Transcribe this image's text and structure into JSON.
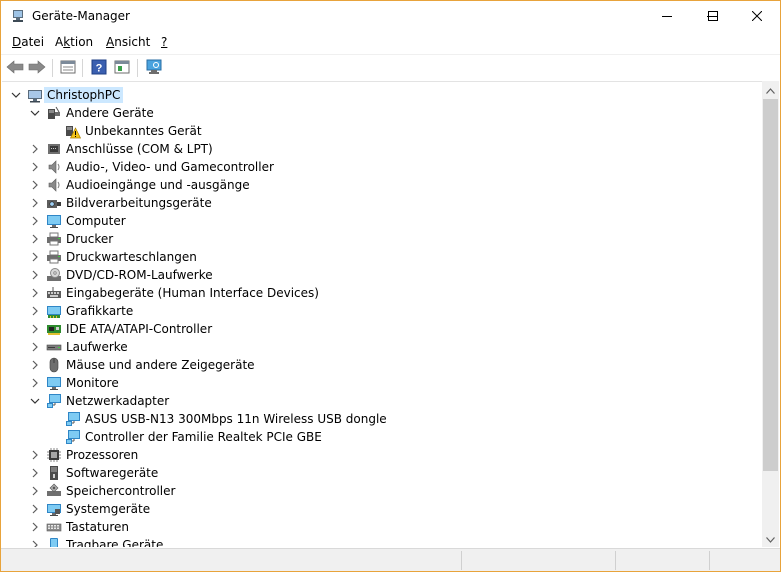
{
  "window": {
    "title": "Geräte-Manager",
    "accent_border_color": "#e8a33b",
    "controls": [
      "minimize-icon",
      "maximize-icon",
      "close-icon"
    ]
  },
  "menu": {
    "items": [
      {
        "label": "Datei",
        "mnemonic_index": 0
      },
      {
        "label": "Aktion",
        "mnemonic_index": 1
      },
      {
        "label": "Ansicht",
        "mnemonic_index": 0
      },
      {
        "label": "?",
        "mnemonic_index": 0
      }
    ]
  },
  "toolbar": {
    "buttons": [
      "back-arrow-icon",
      "forward-arrow-icon",
      "properties-icon",
      "help-icon",
      "update-driver-icon",
      "scan-hardware-icon"
    ]
  },
  "tree": {
    "selection_color": "#cce8ff",
    "nodes": [
      {
        "label": "ChristophPC",
        "level": 0,
        "expander": "expanded",
        "icon": "computer-root-icon",
        "selected": true
      },
      {
        "label": "Andere Geräte",
        "level": 1,
        "expander": "expanded",
        "icon": "other-devices-icon"
      },
      {
        "label": "Unbekanntes Gerät",
        "level": 2,
        "expander": "none",
        "icon": "unknown-device-warning-icon"
      },
      {
        "label": "Anschlüsse (COM & LPT)",
        "level": 1,
        "expander": "collapsed",
        "icon": "port-icon"
      },
      {
        "label": "Audio-, Video- und Gamecontroller",
        "level": 1,
        "expander": "collapsed",
        "icon": "speaker-icon"
      },
      {
        "label": "Audioeingänge und -ausgänge",
        "level": 1,
        "expander": "collapsed",
        "icon": "speaker-icon"
      },
      {
        "label": "Bildverarbeitungsgeräte",
        "level": 1,
        "expander": "collapsed",
        "icon": "camera-icon"
      },
      {
        "label": "Computer",
        "level": 1,
        "expander": "collapsed",
        "icon": "monitor-icon"
      },
      {
        "label": "Drucker",
        "level": 1,
        "expander": "collapsed",
        "icon": "printer-icon"
      },
      {
        "label": "Druckwarteschlangen",
        "level": 1,
        "expander": "collapsed",
        "icon": "printer-icon"
      },
      {
        "label": "DVD/CD-ROM-Laufwerke",
        "level": 1,
        "expander": "collapsed",
        "icon": "disc-drive-icon"
      },
      {
        "label": "Eingabegeräte (Human Interface Devices)",
        "level": 1,
        "expander": "collapsed",
        "icon": "hid-icon"
      },
      {
        "label": "Grafikkarte",
        "level": 1,
        "expander": "collapsed",
        "icon": "display-adapter-icon"
      },
      {
        "label": "IDE ATA/ATAPI-Controller",
        "level": 1,
        "expander": "collapsed",
        "icon": "controller-card-icon"
      },
      {
        "label": "Laufwerke",
        "level": 1,
        "expander": "collapsed",
        "icon": "disk-drive-icon"
      },
      {
        "label": "Mäuse und andere Zeigegeräte",
        "level": 1,
        "expander": "collapsed",
        "icon": "mouse-icon"
      },
      {
        "label": "Monitore",
        "level": 1,
        "expander": "collapsed",
        "icon": "monitor-icon"
      },
      {
        "label": "Netzwerkadapter",
        "level": 1,
        "expander": "expanded",
        "icon": "network-adapter-icon"
      },
      {
        "label": "ASUS USB-N13 300Mbps 11n Wireless USB dongle",
        "level": 2,
        "expander": "none",
        "icon": "network-adapter-icon"
      },
      {
        "label": "Controller der Familie Realtek PCIe GBE",
        "level": 2,
        "expander": "none",
        "icon": "network-adapter-icon"
      },
      {
        "label": "Prozessoren",
        "level": 1,
        "expander": "collapsed",
        "icon": "cpu-icon"
      },
      {
        "label": "Softwaregeräte",
        "level": 1,
        "expander": "collapsed",
        "icon": "software-device-icon"
      },
      {
        "label": "Speichercontroller",
        "level": 1,
        "expander": "collapsed",
        "icon": "storage-controller-icon"
      },
      {
        "label": "Systemgeräte",
        "level": 1,
        "expander": "collapsed",
        "icon": "system-device-icon"
      },
      {
        "label": "Tastaturen",
        "level": 1,
        "expander": "collapsed",
        "icon": "keyboard-icon"
      },
      {
        "label": "Tragbare Geräte",
        "level": 1,
        "expander": "collapsed",
        "icon": "portable-device-icon"
      }
    ]
  },
  "statusbar": {
    "text": ""
  }
}
